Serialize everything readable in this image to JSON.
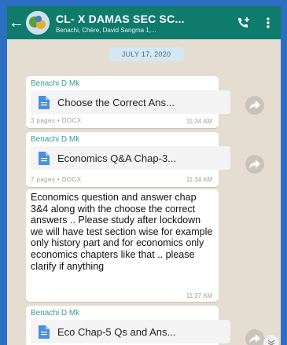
{
  "header": {
    "title": "CL- X DAMAS SEC SC...",
    "subtitle": "Benachi, Chère, David Sangma 1,..."
  },
  "chat": {
    "date": "JULY 17, 2020",
    "messages": [
      {
        "sender": "Benachi D Mk",
        "file_name": "Choose the Correct Ans...",
        "meta": "3 pages • DOCX",
        "time": "11:34 AM"
      },
      {
        "sender": "Benachi D Mk",
        "file_name": "Economics Q&A Chap-3...",
        "meta": "7 pages • DOCX",
        "time": "11:34 AM"
      },
      {
        "text": "Economics question and answer chap 3&4 along with the choose the correct answers .. Please study after lockdown we will have test section wise for example only history part and for economics only economics chapters like that .. please clarify if anything",
        "time": "11:37 AM"
      },
      {
        "sender": "Benachi D Mk",
        "file_name": "Eco Chap-5 Qs and Ans..."
      }
    ]
  },
  "colors": {
    "header": "#0f7b6c",
    "background": "#e6ddd2",
    "sender_name": "#3a9b8f",
    "date_chip": "#d5e7f2",
    "outer_border": "#2a6fc0"
  },
  "icons": [
    "back-arrow-icon",
    "group-avatar",
    "add-call-icon",
    "more-options-icon",
    "document-icon",
    "share-icon",
    "scroll-down-icon"
  ]
}
